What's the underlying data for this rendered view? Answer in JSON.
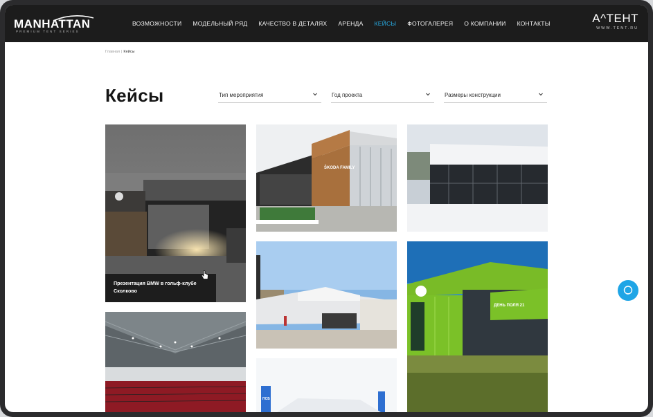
{
  "header": {
    "logo_left": "MANHATTAN",
    "logo_left_sub": "PREMIUM TENT SERIES",
    "logo_right": "A^ТЕНТ",
    "logo_right_sub": "WWW.TENT.RU",
    "nav": [
      {
        "label": "ВОЗМОЖНОСТИ",
        "active": false
      },
      {
        "label": "МОДЕЛЬНЫЙ РЯД",
        "active": false
      },
      {
        "label": "КАЧЕСТВО В ДЕТАЛЯХ",
        "active": false
      },
      {
        "label": "АРЕНДА",
        "active": false
      },
      {
        "label": "КЕЙСЫ",
        "active": true
      },
      {
        "label": "ФОТОГАЛЕРЕЯ",
        "active": false
      },
      {
        "label": "О КОМПАНИИ",
        "active": false
      },
      {
        "label": "КОНТАКТЫ",
        "active": false
      }
    ]
  },
  "breadcrumb": {
    "home": "Главная",
    "separator": "|",
    "current": "Кейсы"
  },
  "page_title": "Кейсы",
  "filters": [
    {
      "label": "Тип мероприятия"
    },
    {
      "label": "Год проекта"
    },
    {
      "label": "Размеры конструкции"
    }
  ],
  "cards": {
    "bmw": {
      "label": "Презентация BMW в гольф-клубе Сколково"
    },
    "skoda_sign": "ŠKODA FAMILY",
    "green_sign": "ДЕНЬ ПОЛЯ 21",
    "bank_sign": "ПСБ"
  },
  "colors": {
    "header_bg": "#1c1c1c",
    "accent": "#27a9e1",
    "chat_button": "#1fa5e6",
    "title": "#151515"
  },
  "icons": {
    "filter_chevron": "chevron-down-icon",
    "chat": "chat-bubble-icon",
    "pointer": "hand-pointer-icon"
  }
}
